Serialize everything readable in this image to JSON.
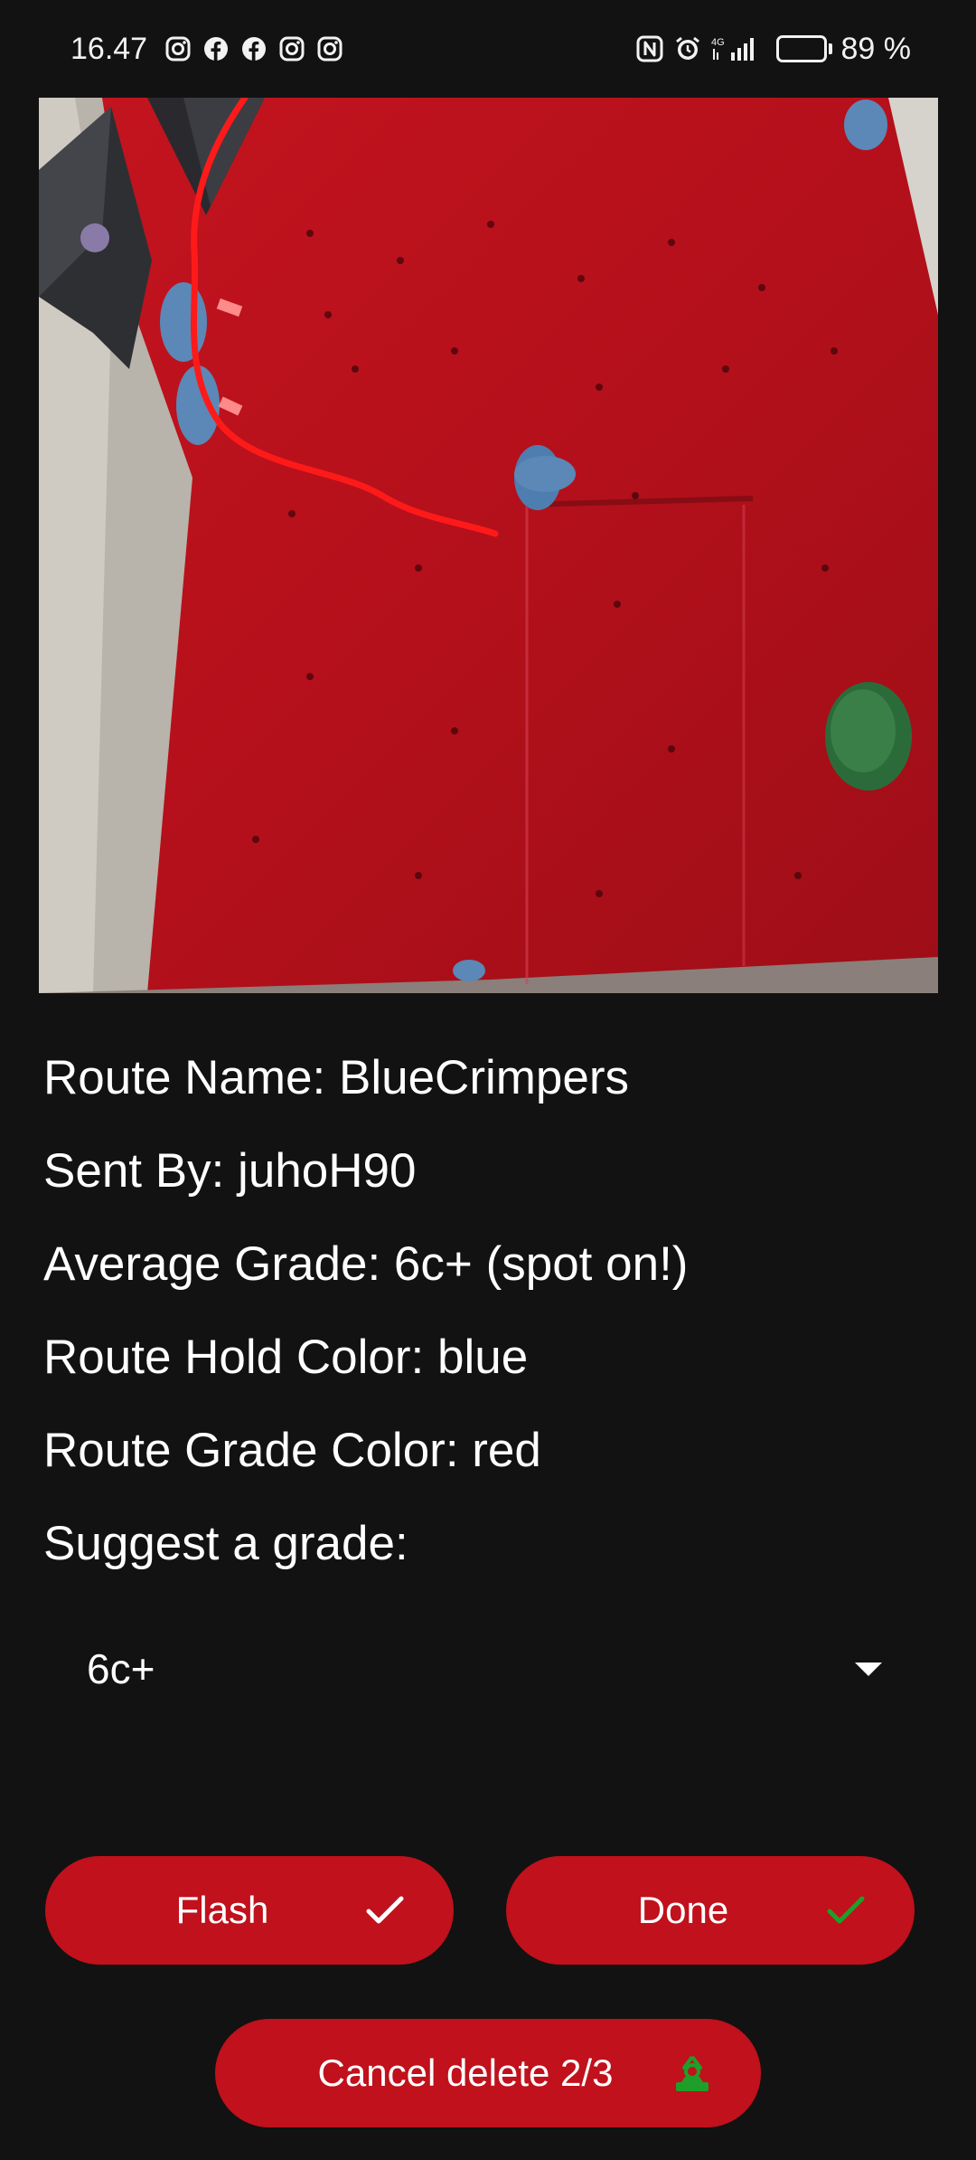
{
  "status_bar": {
    "time": "16.47",
    "notification_icons": [
      "instagram-icon",
      "facebook-icon",
      "facebook-icon",
      "instagram-icon",
      "instagram-icon"
    ],
    "system_icons": [
      "nfc-icon",
      "alarm-icon",
      "signal-4g-icon"
    ],
    "network_label": "4G",
    "battery_percent": "89 %",
    "battery_level": 0.89
  },
  "route": {
    "photo_icon": "climbing-wall-photo",
    "name_line": "Route Name: BlueCrimpers",
    "sent_by_line": "Sent By: juhoH90",
    "average_grade_line": "Average Grade: 6c+ (spot on!)",
    "hold_color_line": "Route Hold Color: blue",
    "grade_color_line": "Route Grade Color: red",
    "suggest_label": "Suggest a grade:"
  },
  "grade_select": {
    "selected": "6c+"
  },
  "buttons": {
    "flash_label": "Flash",
    "done_label": "Done",
    "cancel_delete_label": "Cancel delete 2/3"
  },
  "colors": {
    "background": "#121212",
    "button": "#c0111c",
    "done_check": "#1f9e2a",
    "route_line": "#ff1a1a"
  }
}
